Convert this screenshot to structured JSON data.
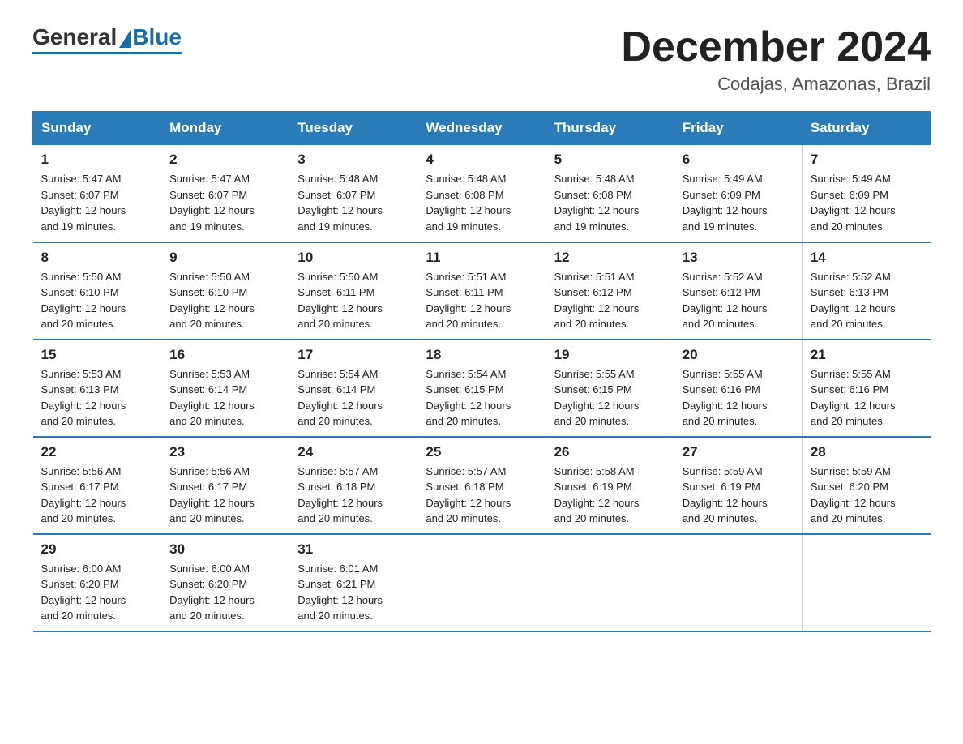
{
  "logo": {
    "general": "General",
    "blue": "Blue"
  },
  "header": {
    "title": "December 2024",
    "location": "Codajas, Amazonas, Brazil"
  },
  "days_of_week": [
    "Sunday",
    "Monday",
    "Tuesday",
    "Wednesday",
    "Thursday",
    "Friday",
    "Saturday"
  ],
  "weeks": [
    [
      {
        "day": "1",
        "sunrise": "5:47 AM",
        "sunset": "6:07 PM",
        "daylight": "12 hours and 19 minutes."
      },
      {
        "day": "2",
        "sunrise": "5:47 AM",
        "sunset": "6:07 PM",
        "daylight": "12 hours and 19 minutes."
      },
      {
        "day": "3",
        "sunrise": "5:48 AM",
        "sunset": "6:07 PM",
        "daylight": "12 hours and 19 minutes."
      },
      {
        "day": "4",
        "sunrise": "5:48 AM",
        "sunset": "6:08 PM",
        "daylight": "12 hours and 19 minutes."
      },
      {
        "day": "5",
        "sunrise": "5:48 AM",
        "sunset": "6:08 PM",
        "daylight": "12 hours and 19 minutes."
      },
      {
        "day": "6",
        "sunrise": "5:49 AM",
        "sunset": "6:09 PM",
        "daylight": "12 hours and 19 minutes."
      },
      {
        "day": "7",
        "sunrise": "5:49 AM",
        "sunset": "6:09 PM",
        "daylight": "12 hours and 20 minutes."
      }
    ],
    [
      {
        "day": "8",
        "sunrise": "5:50 AM",
        "sunset": "6:10 PM",
        "daylight": "12 hours and 20 minutes."
      },
      {
        "day": "9",
        "sunrise": "5:50 AM",
        "sunset": "6:10 PM",
        "daylight": "12 hours and 20 minutes."
      },
      {
        "day": "10",
        "sunrise": "5:50 AM",
        "sunset": "6:11 PM",
        "daylight": "12 hours and 20 minutes."
      },
      {
        "day": "11",
        "sunrise": "5:51 AM",
        "sunset": "6:11 PM",
        "daylight": "12 hours and 20 minutes."
      },
      {
        "day": "12",
        "sunrise": "5:51 AM",
        "sunset": "6:12 PM",
        "daylight": "12 hours and 20 minutes."
      },
      {
        "day": "13",
        "sunrise": "5:52 AM",
        "sunset": "6:12 PM",
        "daylight": "12 hours and 20 minutes."
      },
      {
        "day": "14",
        "sunrise": "5:52 AM",
        "sunset": "6:13 PM",
        "daylight": "12 hours and 20 minutes."
      }
    ],
    [
      {
        "day": "15",
        "sunrise": "5:53 AM",
        "sunset": "6:13 PM",
        "daylight": "12 hours and 20 minutes."
      },
      {
        "day": "16",
        "sunrise": "5:53 AM",
        "sunset": "6:14 PM",
        "daylight": "12 hours and 20 minutes."
      },
      {
        "day": "17",
        "sunrise": "5:54 AM",
        "sunset": "6:14 PM",
        "daylight": "12 hours and 20 minutes."
      },
      {
        "day": "18",
        "sunrise": "5:54 AM",
        "sunset": "6:15 PM",
        "daylight": "12 hours and 20 minutes."
      },
      {
        "day": "19",
        "sunrise": "5:55 AM",
        "sunset": "6:15 PM",
        "daylight": "12 hours and 20 minutes."
      },
      {
        "day": "20",
        "sunrise": "5:55 AM",
        "sunset": "6:16 PM",
        "daylight": "12 hours and 20 minutes."
      },
      {
        "day": "21",
        "sunrise": "5:55 AM",
        "sunset": "6:16 PM",
        "daylight": "12 hours and 20 minutes."
      }
    ],
    [
      {
        "day": "22",
        "sunrise": "5:56 AM",
        "sunset": "6:17 PM",
        "daylight": "12 hours and 20 minutes."
      },
      {
        "day": "23",
        "sunrise": "5:56 AM",
        "sunset": "6:17 PM",
        "daylight": "12 hours and 20 minutes."
      },
      {
        "day": "24",
        "sunrise": "5:57 AM",
        "sunset": "6:18 PM",
        "daylight": "12 hours and 20 minutes."
      },
      {
        "day": "25",
        "sunrise": "5:57 AM",
        "sunset": "6:18 PM",
        "daylight": "12 hours and 20 minutes."
      },
      {
        "day": "26",
        "sunrise": "5:58 AM",
        "sunset": "6:19 PM",
        "daylight": "12 hours and 20 minutes."
      },
      {
        "day": "27",
        "sunrise": "5:59 AM",
        "sunset": "6:19 PM",
        "daylight": "12 hours and 20 minutes."
      },
      {
        "day": "28",
        "sunrise": "5:59 AM",
        "sunset": "6:20 PM",
        "daylight": "12 hours and 20 minutes."
      }
    ],
    [
      {
        "day": "29",
        "sunrise": "6:00 AM",
        "sunset": "6:20 PM",
        "daylight": "12 hours and 20 minutes."
      },
      {
        "day": "30",
        "sunrise": "6:00 AM",
        "sunset": "6:20 PM",
        "daylight": "12 hours and 20 minutes."
      },
      {
        "day": "31",
        "sunrise": "6:01 AM",
        "sunset": "6:21 PM",
        "daylight": "12 hours and 20 minutes."
      },
      null,
      null,
      null,
      null
    ]
  ],
  "labels": {
    "sunrise": "Sunrise:",
    "sunset": "Sunset:",
    "daylight": "Daylight:"
  }
}
